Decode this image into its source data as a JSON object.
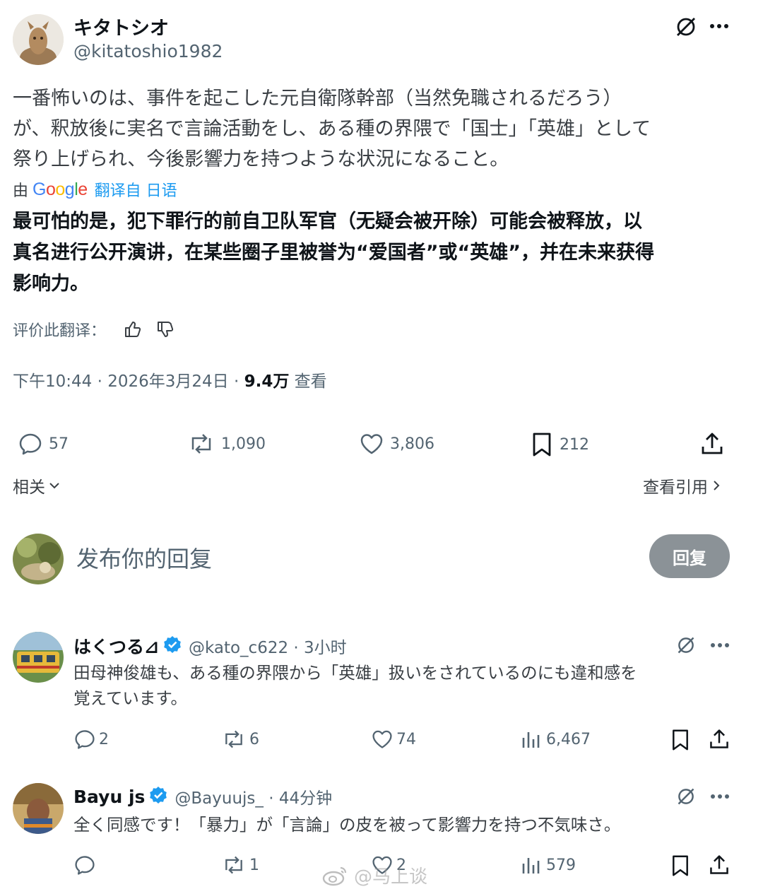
{
  "main_post": {
    "display_name": "キタトシオ",
    "handle": "@kitatoshio1982",
    "original_text": [
      "一番怖いのは、事件を起こした元自衛隊幹部（当然免職されるだろう）",
      "が、釈放後に実名で言論活動をし、ある種の界隈で「国士」「英雄」として",
      "祭り上げられ、今後影響力を持つような状況になること。"
    ],
    "translation_by": "由",
    "translation_brand": "Google",
    "translation_from": "翻译自 日语",
    "translated_text": [
      "最可怕的是，犯下罪行的前自卫队军官（无疑会被开除）可能会被释放，以",
      "真名进行公开演讲，在某些圈子里被誉为“爱国者”或“英雄”，并在未来获得",
      "影响力。"
    ],
    "rate_label": "评价此翻译：",
    "timestamp": "下午10:44 · 2026年3月24日 · ",
    "views_count": "9.4万",
    "views_label": " 查看",
    "stats": {
      "replies": "57",
      "reposts": "1,090",
      "likes": "3,806",
      "bookmarks": "212"
    },
    "related_label": "相关",
    "quotes_label": "查看引用"
  },
  "compose": {
    "placeholder": "发布你的回复",
    "reply_button": "回复"
  },
  "replies": [
    {
      "display_name": "はくつる⊿",
      "meta": "@kato_c622 · 3小时",
      "text": [
        "田母神俊雄も、ある種の界隈から「英雄」扱いをされているのにも違和感を",
        "覚えています。"
      ],
      "stats": {
        "replies": "2",
        "reposts": "6",
        "likes": "74",
        "views": "6,467"
      }
    },
    {
      "display_name": "Bayu js",
      "meta": "@Bayuujs_ · 44分钟",
      "text": [
        "全く同感です！「暴力」が「言論」の皮を被って影響力を持つ不気味さ。"
      ],
      "stats": {
        "replies": "",
        "reposts": "1",
        "likes": "2",
        "views": "579"
      }
    }
  ],
  "watermark": "@马上谈",
  "colors": {
    "verified": "#1d9bf0",
    "link": "#1d9bf0",
    "muted": "#536471",
    "reply_button": "#8b9297"
  }
}
